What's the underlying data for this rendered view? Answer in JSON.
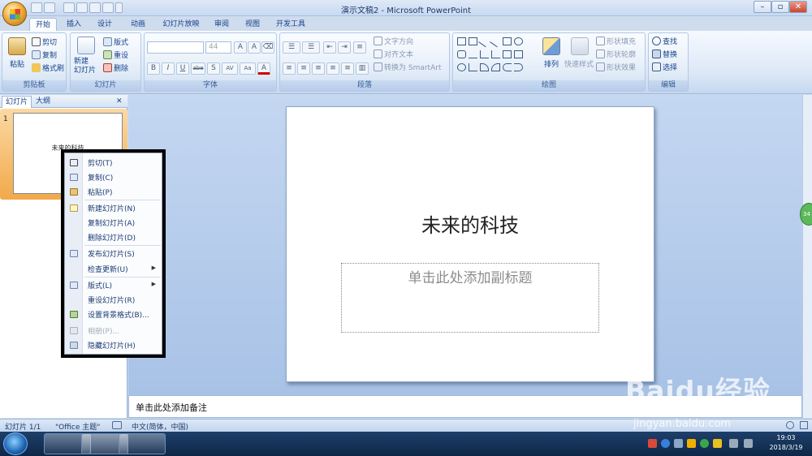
{
  "window": {
    "title": "演示文稿2 - Microsoft PowerPoint",
    "minimize": "–",
    "maximize": "▫",
    "close": "✕"
  },
  "tabs": [
    "开始",
    "插入",
    "设计",
    "动画",
    "幻灯片放映",
    "审阅",
    "视图",
    "开发工具"
  ],
  "ribbon": {
    "clipboard": {
      "label": "剪贴板",
      "paste": "粘贴",
      "cut": "剪切",
      "copy": "复制",
      "format_painter": "格式刷"
    },
    "slides": {
      "label": "幻灯片",
      "new_slide": "新建\n幻灯片",
      "layout": "版式",
      "reset": "重设",
      "delete": "删除"
    },
    "font": {
      "label": "字体",
      "font_size": "44",
      "buttons": [
        "B",
        "I",
        "U",
        "abe",
        "S",
        "AV",
        "Aa",
        "A"
      ]
    },
    "paragraph": {
      "label": "段落",
      "text_direction": "文字方向",
      "align_text": "对齐文本",
      "smartart": "转换为 SmartArt"
    },
    "drawing": {
      "label": "绘图",
      "arrange": "排列",
      "quick_styles": "快速样式",
      "shape_fill": "形状填充",
      "shape_outline": "形状轮廓",
      "shape_effects": "形状效果"
    },
    "editing": {
      "label": "编辑",
      "find": "查找",
      "replace": "替换",
      "select": "选择"
    }
  },
  "pane": {
    "tab_slides": "幻灯片",
    "tab_outline": "大纲",
    "close": "✕",
    "slide_number": "1",
    "thumb_title": "未来的科技"
  },
  "slide": {
    "title": "未来的科技",
    "subtitle_placeholder": "单击此处添加副标题"
  },
  "notes": {
    "placeholder": "单击此处添加备注"
  },
  "context_menu": {
    "items": [
      {
        "label": "剪切(T)",
        "icon": "scissors-icon",
        "disabled": false
      },
      {
        "label": "复制(C)",
        "icon": "copy-icon",
        "disabled": false
      },
      {
        "label": "粘贴(P)",
        "icon": "paste-icon",
        "disabled": false
      },
      {
        "label": "新建幻灯片(N)",
        "icon": "new-slide-icon",
        "disabled": false
      },
      {
        "label": "复制幻灯片(A)",
        "icon": "",
        "disabled": false
      },
      {
        "label": "删除幻灯片(D)",
        "icon": "",
        "disabled": false
      },
      {
        "label": "发布幻灯片(S)",
        "icon": "publish-icon",
        "disabled": false
      },
      {
        "label": "检查更新(U)",
        "icon": "",
        "disabled": false
      },
      {
        "label": "版式(L)",
        "icon": "layout-icon",
        "disabled": false
      },
      {
        "label": "重设幻灯片(R)",
        "icon": "",
        "disabled": false
      },
      {
        "label": "设置背景格式(B)...",
        "icon": "background-icon",
        "disabled": false
      },
      {
        "label": "相册(P)...",
        "icon": "photo-album-icon",
        "disabled": true
      },
      {
        "label": "隐藏幻灯片(H)",
        "icon": "hide-slide-icon",
        "disabled": false
      }
    ]
  },
  "status": {
    "slide_info": "幻灯片 1/1",
    "theme": "\"Office 主题\"",
    "language": "中文(简体，中国)"
  },
  "taskbar": {
    "time": "19:03",
    "date": "2018/3/19"
  },
  "watermark": {
    "text": "Baidu经验",
    "url": "jingyan.baidu.com"
  },
  "bubble": {
    "text": "34"
  }
}
